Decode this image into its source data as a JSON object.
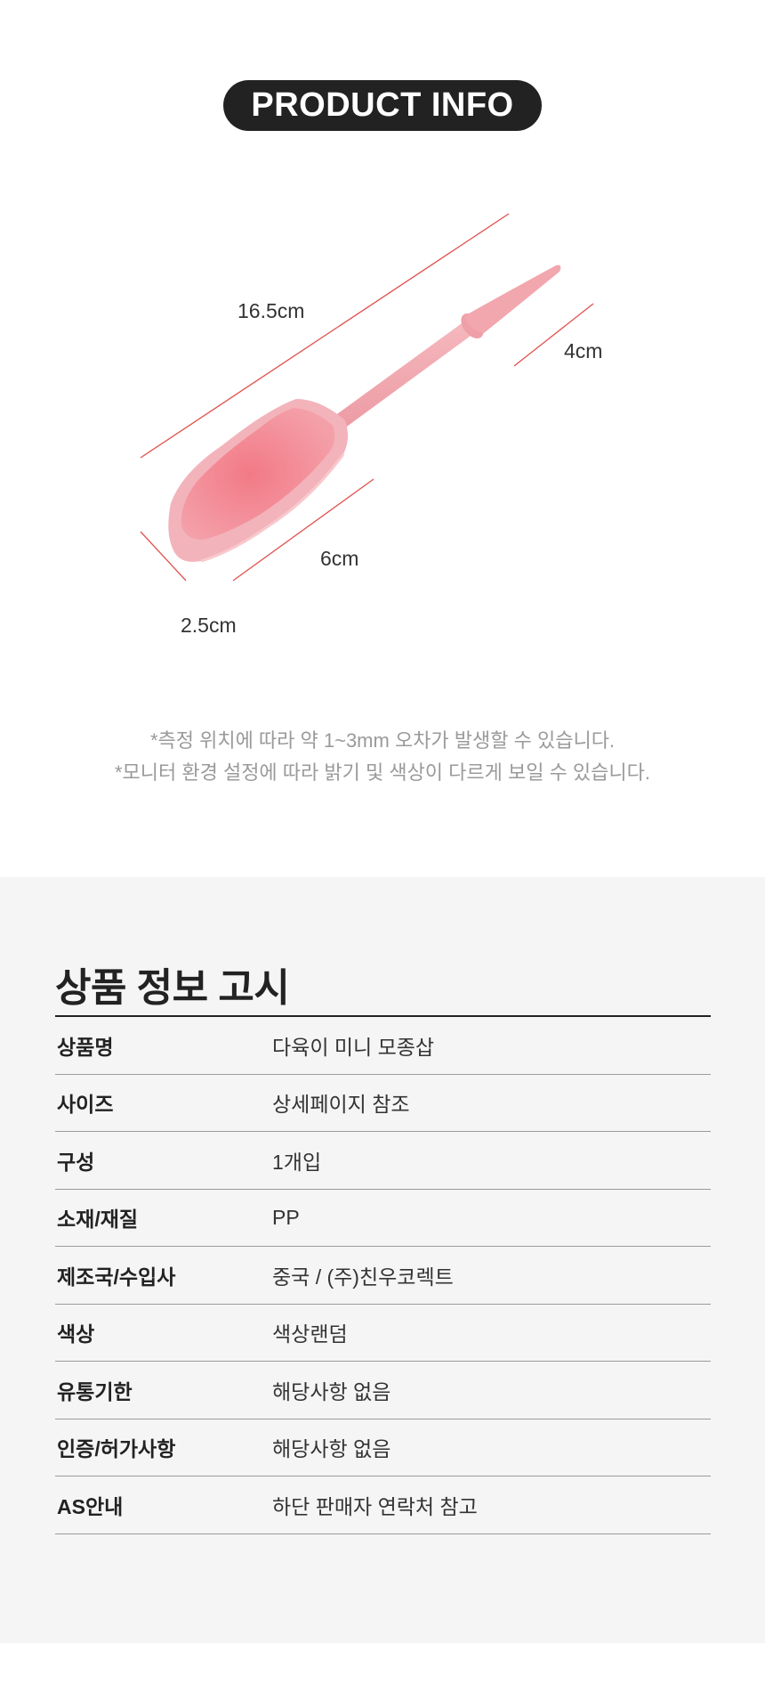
{
  "header": {
    "badge": "PRODUCT INFO"
  },
  "dimensions": {
    "length": "16.5cm",
    "tip": "4cm",
    "scoop_length": "6cm",
    "scoop_width": "2.5cm"
  },
  "notes": [
    "*측정 위치에 따라 약 1~3mm 오차가 발생할 수 있습니다.",
    "*모니터 환경 설정에 따라 밝기 및 색상이 다르게 보일 수 있습니다."
  ],
  "notice": {
    "title": "상품 정보 고시",
    "rows": [
      {
        "label": "상품명",
        "value": "다육이 미니 모종삽"
      },
      {
        "label": "사이즈",
        "value": "상세페이지 참조"
      },
      {
        "label": "구성",
        "value": "1개입"
      },
      {
        "label": "소재/재질",
        "value": "PP"
      },
      {
        "label": "제조국/수입사",
        "value": "중국 / (주)친우코렉트"
      },
      {
        "label": "색상",
        "value": "색상랜덤"
      },
      {
        "label": "유통기한",
        "value": "해당사항 없음"
      },
      {
        "label": "인증/허가사항",
        "value": "해당사항 없음"
      },
      {
        "label": "AS안내",
        "value": "하단 판매자 연락처 참고"
      }
    ]
  },
  "colors": {
    "badge_bg": "#222222",
    "dimension_line": "#e0524f",
    "product_pink": "#f2a6ad",
    "section_bg": "#f5f5f5"
  }
}
